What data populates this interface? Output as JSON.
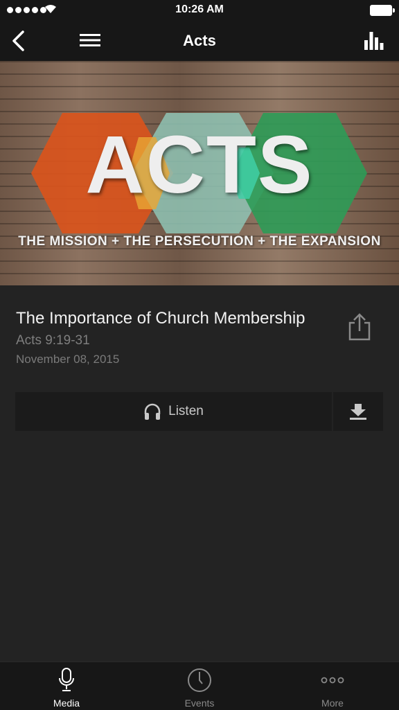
{
  "status": {
    "time": "10:26 AM"
  },
  "nav": {
    "title": "Acts",
    "icons": [
      "back-chevron-icon",
      "menu-icon",
      "bar-chart-icon"
    ]
  },
  "hero": {
    "title": "ACTS",
    "subtitle": "THE MISSION + THE PERSECUTION + THE EXPANSION",
    "hex_colors": [
      "#d9541c",
      "#7fb8a8",
      "#2e9b57"
    ]
  },
  "sermon": {
    "title": "The Importance of Church Membership",
    "passage": "Acts 9:19-31",
    "date": "November 08, 2015"
  },
  "actions": {
    "listen_label": "Listen",
    "listen_icon": "headphones-icon",
    "download_icon": "download-icon",
    "share_icon": "share-icon"
  },
  "tabs": [
    {
      "label": "Media",
      "icon": "microphone-icon",
      "active": true
    },
    {
      "label": "Events",
      "icon": "clock-icon",
      "active": false
    },
    {
      "label": "More",
      "icon": "more-dots-icon",
      "active": false
    }
  ]
}
